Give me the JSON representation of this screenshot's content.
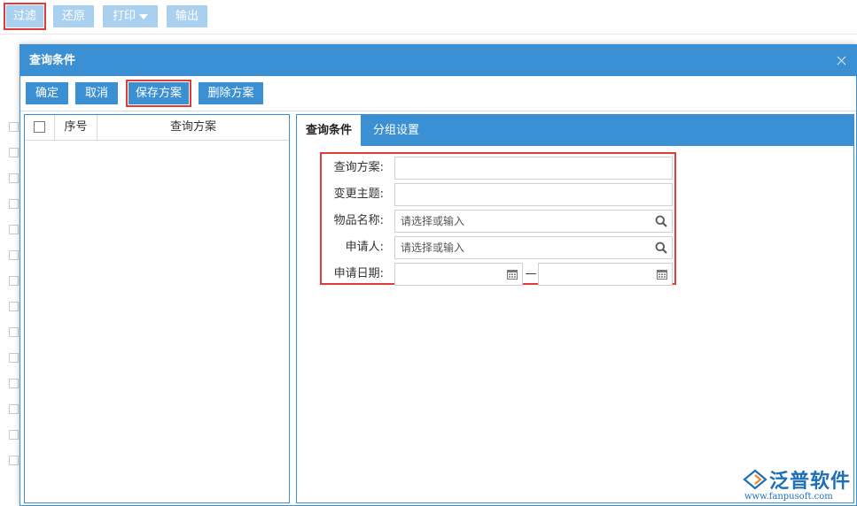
{
  "top_toolbar": {
    "filter": "过滤",
    "restore": "还原",
    "print": "打印",
    "export": "输出"
  },
  "dialog": {
    "title": "查询条件",
    "buttons": {
      "ok": "确定",
      "cancel": "取消",
      "save_plan": "保存方案",
      "delete_plan": "删除方案"
    },
    "list": {
      "columns": [
        "序号",
        "查询方案"
      ]
    },
    "tabs": [
      {
        "label": "查询条件",
        "active": true
      },
      {
        "label": "分组设置",
        "active": false
      }
    ],
    "form": {
      "query_plan": {
        "label": "查询方案:",
        "value": ""
      },
      "change_subject": {
        "label": "变更主题:",
        "value": ""
      },
      "item_name": {
        "label": "物品名称:",
        "placeholder": "请选择或输入"
      },
      "applicant": {
        "label": "申请人:",
        "placeholder": "请选择或输入"
      },
      "apply_date": {
        "label": "申请日期:",
        "separator": "—",
        "from": "",
        "to": ""
      }
    }
  },
  "watermark": {
    "brand": "泛普软件",
    "url": "www.fanpusoft.com"
  },
  "colors": {
    "accent": "#3b8fd3",
    "toolbar_disabled": "#a9d0ee",
    "highlight": "#e03b3b"
  },
  "icons": [
    "search-icon",
    "calendar-icon",
    "close-icon",
    "caret-down-icon"
  ]
}
